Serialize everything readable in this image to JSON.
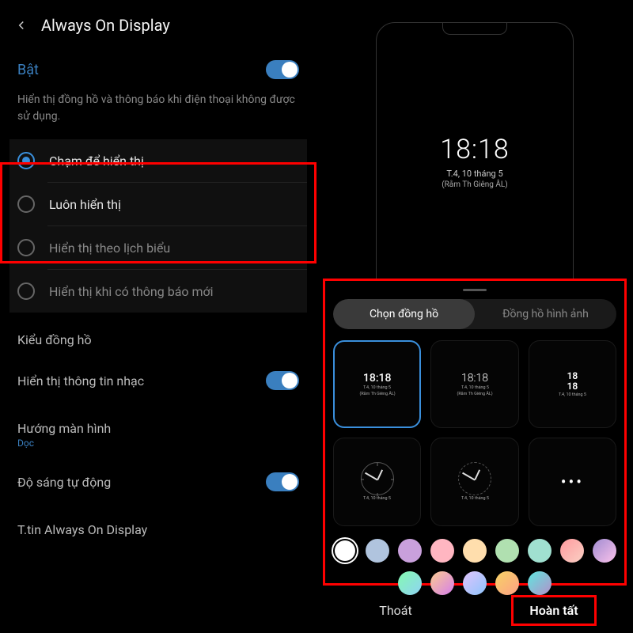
{
  "header": {
    "title": "Always On Display"
  },
  "enable": {
    "label": "Bật",
    "on": true
  },
  "description": "Hiển thị đồng hồ và thông báo khi điện thoại không được sử dụng.",
  "modes": [
    {
      "label": "Chạm để hiển thị",
      "selected": true
    },
    {
      "label": "Luôn hiển thị",
      "selected": false
    },
    {
      "label": "Hiển thị theo lịch biểu",
      "selected": false
    },
    {
      "label": "Hiển thị khi có thông báo mới",
      "selected": false
    }
  ],
  "settings": {
    "clock_style": "Kiểu đồng hồ",
    "music_info": "Hiển thị thông tin nhạc",
    "orientation_label": "Hướng màn hình",
    "orientation_value": "Dọc",
    "auto_brightness": "Độ sáng tự động",
    "aod_info": "T.tin Always On Display"
  },
  "preview": {
    "time": "18:18",
    "date": "T.4, 10 tháng 5",
    "lunar": "(Rằm Th Giêng ÂL)"
  },
  "picker": {
    "tabs": {
      "clock": "Chọn đồng hồ",
      "image": "Đồng hồ hình ảnh"
    },
    "tiles": {
      "digital1": {
        "time": "18:18",
        "sub1": "T.4, 10 tháng 5",
        "sub2": "(Rằm Th Giêng ÂL)"
      },
      "digital2": {
        "time": "18:18",
        "sub1": "T.4, 10 tháng 5",
        "sub2": "(Rằm Th Giêng ÂL)"
      },
      "digital3": {
        "h": "18",
        "m": "18",
        "sub": "T.4, 10 tháng 5"
      },
      "analog_sub": "T.4, 10 tháng 5"
    },
    "colors": [
      "#ffffff",
      "#b0c4de",
      "#c9a0dc",
      "#ffb6c1",
      "#ffdead",
      "#b0e0b0",
      "#a0e0d0",
      "linear-gradient(135deg,#ff9a9e,#fad0c4)",
      "linear-gradient(135deg,#a18cd1,#fbc2eb)",
      "linear-gradient(135deg,#84fab0,#8fd3f4)",
      "linear-gradient(135deg,#fccb90,#d57eeb)",
      "linear-gradient(135deg,#e0c3fc,#8ec5fc)",
      "linear-gradient(135deg,#f6d365,#fda085)",
      "linear-gradient(135deg,#5ee7df,#b490ca)"
    ]
  },
  "bottom": {
    "cancel": "Thoát",
    "done": "Hoàn tất"
  }
}
